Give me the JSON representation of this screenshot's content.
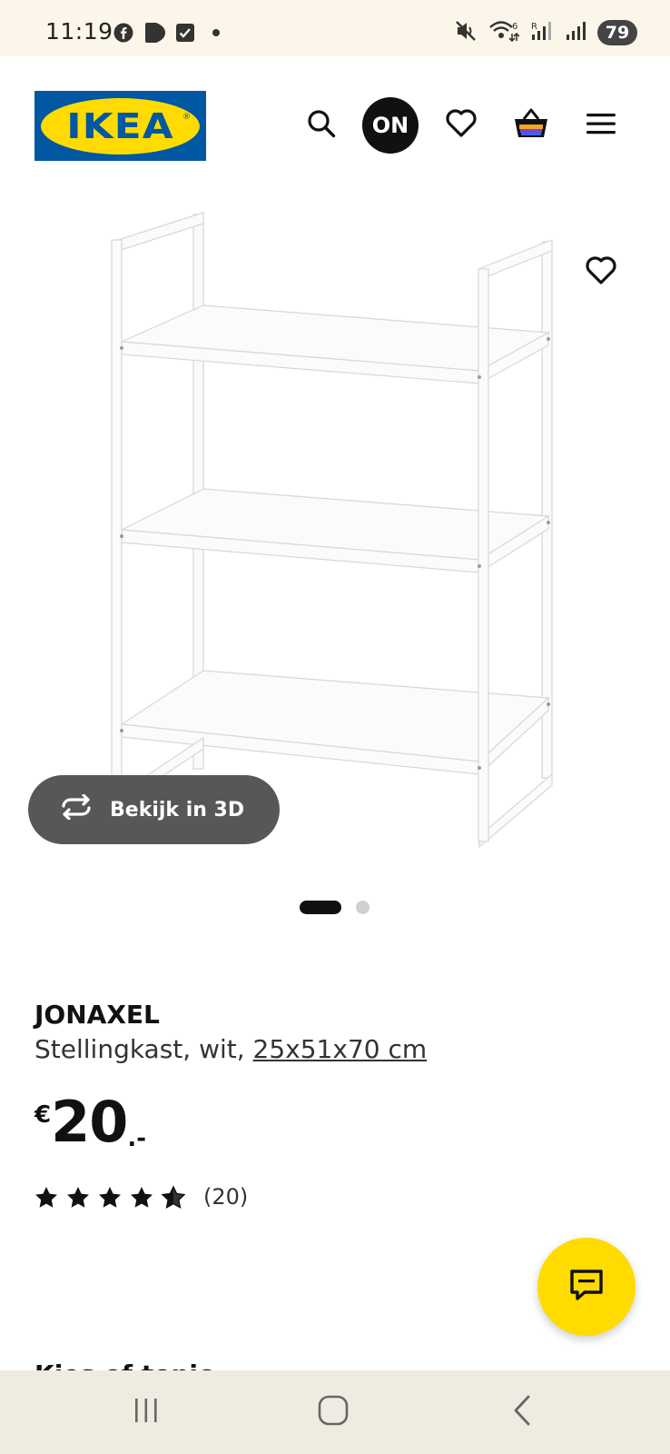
{
  "status_bar": {
    "time": "11:19",
    "battery": "79",
    "icons_left": [
      "facebook-icon",
      "play-icon",
      "checkbox-icon",
      "dot-icon"
    ],
    "icons_right": [
      "mute-icon",
      "wifi-icon",
      "signal-icon",
      "signal-icon",
      "battery-icon"
    ]
  },
  "header": {
    "logo_text": "IKEA",
    "logo_reg": "®",
    "store_badge": "ON",
    "icons": [
      "search-icon",
      "heart-icon",
      "basket-icon",
      "menu-icon"
    ],
    "colors": {
      "brand_blue": "#0058a3",
      "brand_yellow": "#ffdb00"
    }
  },
  "product_image": {
    "view_3d_label": "Bekijk in 3D",
    "carousel_total": 2,
    "carousel_active": 1
  },
  "product": {
    "name": "JONAXEL",
    "description": "Stellingkast, wit, ",
    "size": "25x51x70 cm",
    "currency": "€",
    "price": "20",
    "price_suffix": ".-",
    "rating": 4.5,
    "rating_max": 5,
    "rating_count": "(20)"
  },
  "chat_button": {
    "icon": "chat-icon"
  },
  "cutoff_heading": "Kies of tonic",
  "nav_bar": {
    "icons": [
      "recent-apps-icon",
      "home-icon",
      "back-icon"
    ]
  }
}
